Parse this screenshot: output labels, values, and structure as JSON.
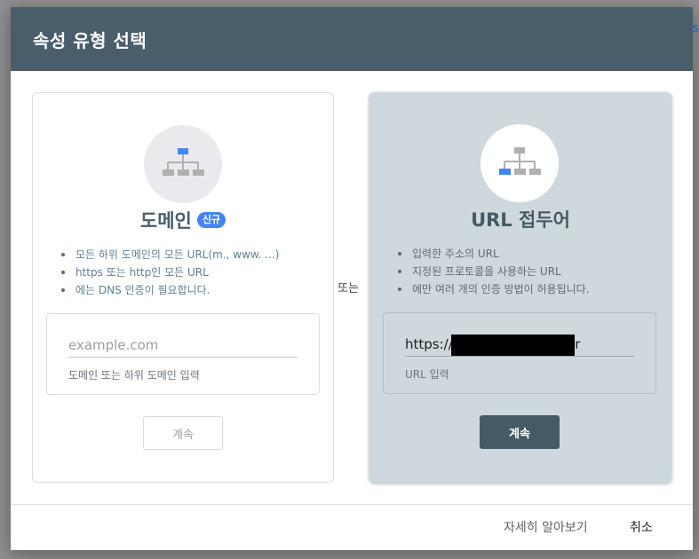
{
  "backdrop": {
    "fragment": "s"
  },
  "dialog": {
    "title": "속성 유형 선택",
    "separator": "또는",
    "footer": {
      "learn_more": "자세히 알아보기",
      "cancel": "취소"
    }
  },
  "domain_card": {
    "title": "도메인",
    "badge": "신규",
    "bullets": [
      "모든 하위 도메인의 모든 URL(m., www. ...)",
      "https 또는 http인 모든 URL",
      "에는 DNS 인증이 필요합니다."
    ],
    "input_placeholder": "example.com",
    "input_value": "",
    "input_hint": "도메인 또는 하위 도메인 입력",
    "button": "계속",
    "icon": "sitemap-top-highlight-icon",
    "accent": "#4285f4"
  },
  "url_card": {
    "title": "URL 접두어",
    "bullets": [
      "입력한 주소의 URL",
      "지정된 프로토콜을 사용하는 URL",
      "에만 여러 개의 인증 방법이 허용됩니다."
    ],
    "input_value": "https://                          .kr",
    "input_hint": "URL 입력",
    "button": "계속",
    "icon": "sitemap-leaf-highlight-icon",
    "accent": "#4285f4"
  },
  "colors": {
    "header": "#4a5d6b",
    "selected_card": "#cfd8dc",
    "primary_button": "#455a64"
  }
}
